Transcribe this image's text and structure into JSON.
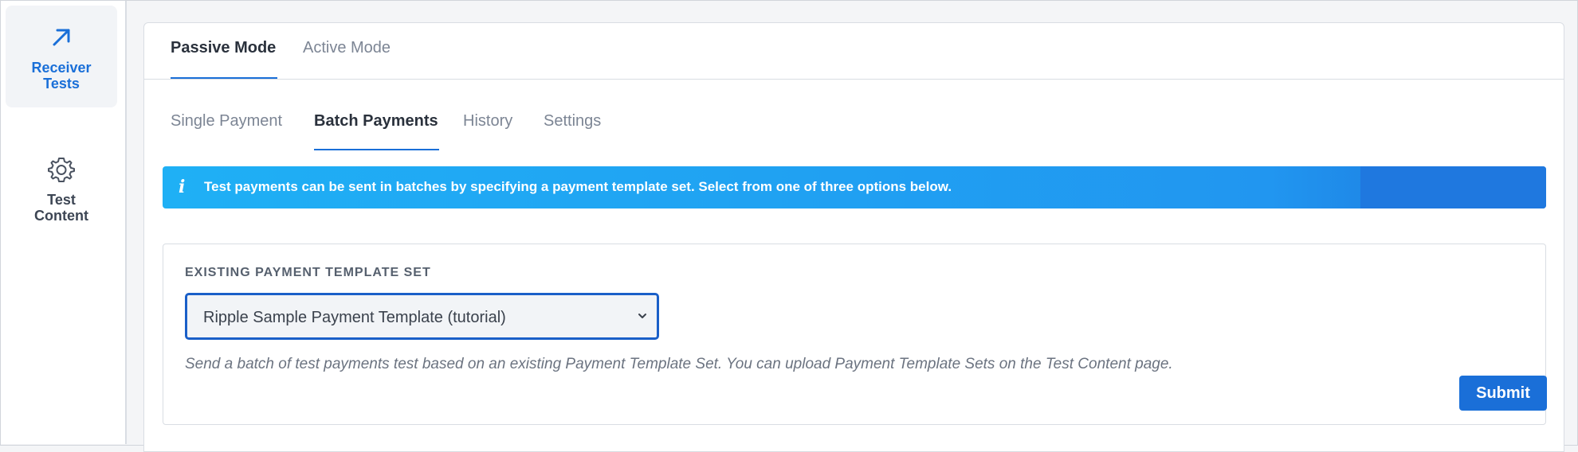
{
  "sidebar": {
    "items": [
      {
        "label_line1": "Receiver",
        "label_line2": "Tests",
        "icon": "arrow-up-right-icon",
        "active": true
      },
      {
        "label_line1": "Test",
        "label_line2": "Content",
        "icon": "gear-icon",
        "active": false
      }
    ]
  },
  "mode_tabs": [
    {
      "label": "Passive Mode",
      "active": true
    },
    {
      "label": "Active Mode",
      "active": false
    }
  ],
  "sub_tabs": [
    {
      "label": "Single Payment",
      "active": false
    },
    {
      "label": "Batch Payments",
      "active": true
    },
    {
      "label": "History",
      "active": false
    },
    {
      "label": "Settings",
      "active": false
    }
  ],
  "alert": {
    "icon": "info-icon",
    "text": "Test payments can be sent in batches by specifying a payment template set. Select from one of three options below."
  },
  "form": {
    "label": "EXISTING PAYMENT TEMPLATE SET",
    "selected": "Ripple Sample Payment Template (tutorial)",
    "help": "Send a batch of test payments test based on an existing Payment Template Set. You can upload Payment Template Sets on the Test Content page.",
    "submit_label": "Submit"
  },
  "colors": {
    "accent": "#1a6fd8",
    "alert_start": "#1fb0f5",
    "alert_end": "#1a6fd8"
  }
}
